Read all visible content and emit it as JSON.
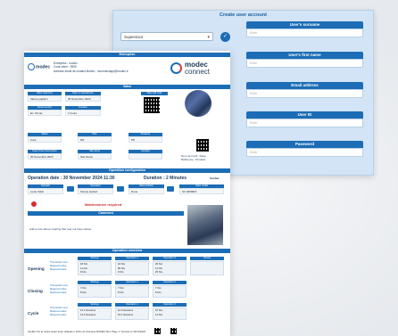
{
  "create_user": {
    "title": "Create user account",
    "role_selected": "Supervisor",
    "fields": [
      {
        "label": "User's surname",
        "placeholder": "Enter"
      },
      {
        "label": "User's first name",
        "placeholder": "Enter"
      },
      {
        "label": "Email address",
        "placeholder": "Enter"
      },
      {
        "label": "User ID",
        "placeholder": "Enter"
      },
      {
        "label": "Password",
        "placeholder": "Enter"
      }
    ]
  },
  "report": {
    "company_bar": "Entreprise",
    "enterprise_label": "Entreprise : modec",
    "client_code": "Code client : 9999",
    "contact": "Adresse email de contact Modec : mconnectapp@modec.fr",
    "small_logo": "modec",
    "big_logo_line1": "modec",
    "big_logo_line2": "connect",
    "valve_bar": "Valve",
    "valve_cells": [
      {
        "h": "Valve reference",
        "v": "Vanne papillon"
      },
      {
        "h": "Date of manufacture",
        "v": "30 November 2023"
      },
      {
        "h": "Valve QR code",
        "v": ""
      },
      {
        "h": "Serial number",
        "v": "Ex: 00 set"
      },
      {
        "h": "Duration",
        "v": "1 hours"
      },
      {
        "h": "Status",
        "v": "Créé"
      },
      {
        "h": "Size",
        "v": "DN"
      },
      {
        "h": "Pressure",
        "v": "PN"
      },
      {
        "h": "Temperature",
        "v": ""
      },
      {
        "h": "Date of last intervention",
        "v": "30 November 2023"
      },
      {
        "h": "Site name",
        "v": "Site Name"
      },
      {
        "h": "Actuator",
        "v": ""
      }
    ],
    "qr_caption_1": "Nom de l'outil : Rope",
    "qr_caption_2": "Référence : Produits",
    "config_bar": "Operation configuration",
    "operation_date": "Operation date : 30 November 2024 11:30",
    "duration": "Duration : 2 Minutes",
    "status_right": "Guided",
    "config_cells": [
      {
        "h": "Operator",
        "v": "Lucie Vidal"
      },
      {
        "h": "Operation",
        "v": "Simply started"
      },
      {
        "h": "Valve position",
        "v": "Done"
      },
      {
        "h": "Valve model",
        "v": "SV 0000007"
      }
    ],
    "maintenance": "Maintenance required",
    "comment_bar": "Comment",
    "comment_text": "Add a note above creating that may not have valves.",
    "overview_bar": "Operation overview",
    "overview_cols": [
      "Settings",
      "Operation 1",
      "Operation 2",
      "Result"
    ],
    "rows": [
      {
        "label": "Opening",
        "sub": [
          "Theoretical curve",
          "Measured value",
          "Measured value"
        ],
        "c1": [
          "18 Nm",
          "11 Nm",
          "8 Nm"
        ],
        "c2": [
          "19 Nm",
          "82 Nm",
          "9 Nm"
        ],
        "c3": [
          "20 Nm",
          "11 Nm",
          "25 Nm"
        ]
      },
      {
        "label": "Closing",
        "sub": [
          "Theoretical curve",
          "Measured value",
          "Measured value"
        ],
        "c1": [
          "7 Nm",
          "8 Nm"
        ],
        "c2": [
          "7 Nm",
          "8 Nm"
        ],
        "c3": [
          "7 Nm",
          "8 Nm"
        ]
      },
      {
        "label": "Cycle",
        "sub": [
          "Theoretical curve",
          "Measured value",
          "Measured value"
        ],
        "c1": [
          "14.1 Newtons",
          "13.4 Newtons"
        ],
        "c2": [
          "12.9 Newtons",
          "15.1 Newtons"
        ],
        "c3": [
          "16 Nm",
          "14 Nm"
        ]
      }
    ],
    "footer": "Veuillez lire la notice avant toute utilisation. Fiche de données MODEC Ref. Page 1 / Généré le 30/11/2024"
  }
}
